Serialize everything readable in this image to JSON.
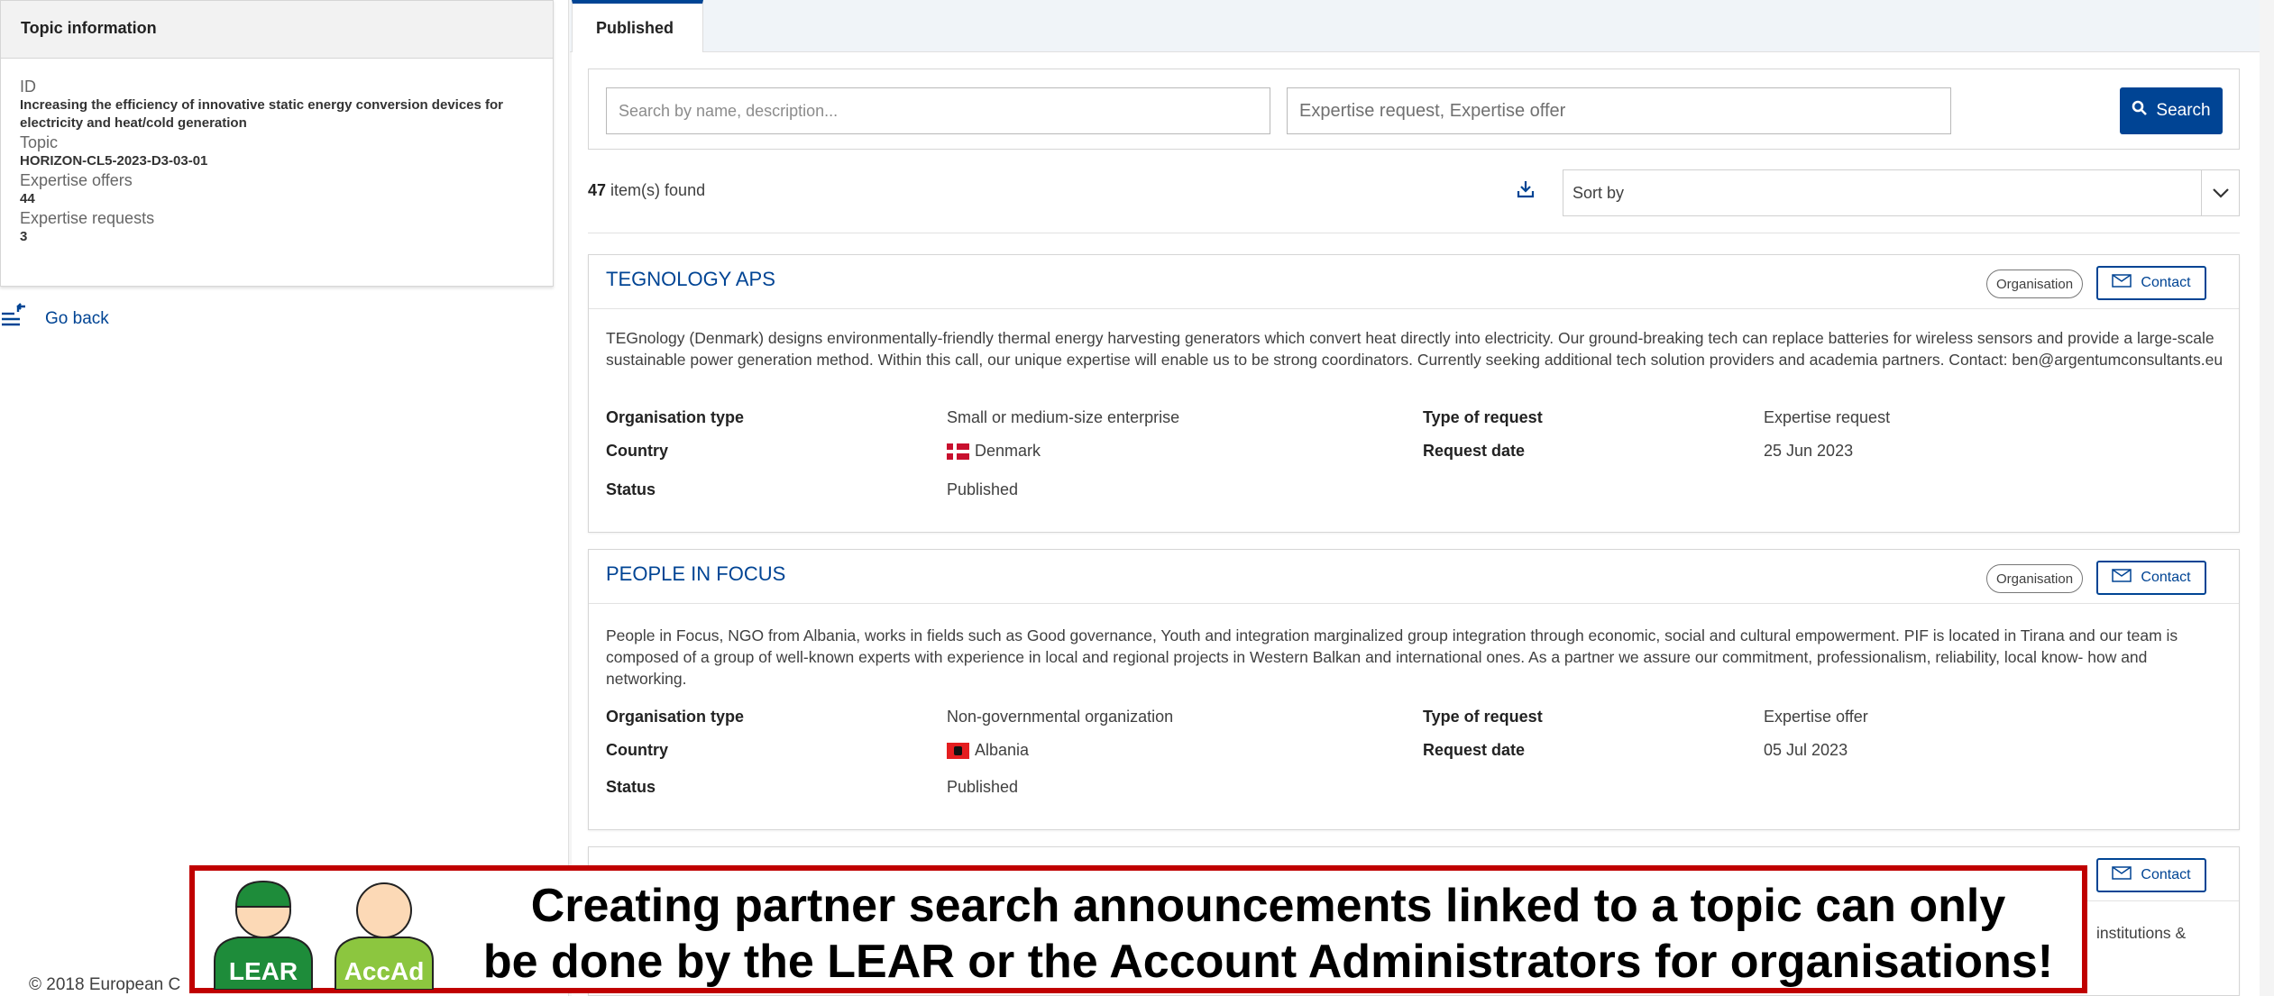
{
  "topic_panel": {
    "header": "Topic information",
    "id_label": "ID",
    "id_value": "Increasing the efficiency of innovative static energy conversion devices for electricity and heat/cold generation",
    "topic_label": "Topic",
    "topic_value": "HORIZON-CL5-2023-D3-03-01",
    "offers_label": "Expertise offers",
    "offers_value": "44",
    "requests_label": "Expertise requests",
    "requests_value": "3"
  },
  "go_back_label": "Go back",
  "tabs": [
    {
      "label": "Published"
    }
  ],
  "search": {
    "name_placeholder": "Search by name, description...",
    "type_value": "Expertise request, Expertise offer",
    "button_label": "Search"
  },
  "results": {
    "count": "47",
    "suffix": "item(s) found"
  },
  "sort": {
    "label": "Sort by"
  },
  "labels": {
    "organisation_type": "Organisation type",
    "country": "Country",
    "status": "Status",
    "type_of_request": "Type of request",
    "request_date": "Request date",
    "badge": "Organisation",
    "contact": "Contact"
  },
  "cards": [
    {
      "title": "TEGNOLOGY APS",
      "description": "TEGnology (Denmark) designs environmentally-friendly thermal energy harvesting generators which convert heat directly into electricity. Our ground-breaking tech can replace batteries for wireless sensors and provide a large-scale sustainable power generation method. Within this call, our unique expertise will enable us to be strong coordinators. Currently seeking additional tech solution providers and academia partners. Contact: ben@argentumconsultants.eu",
      "organisation_type": "Small or medium-size enterprise",
      "country": "Denmark",
      "status": "Published",
      "type_of_request": "Expertise request",
      "request_date": "25 Jun 2023"
    },
    {
      "title": "PEOPLE IN FOCUS",
      "description": "People in Focus, NGO from Albania, works in fields such as Good governance, Youth and integration marginalized group integration through economic, social and cultural empowerment. PIF is located in Tirana and our team is composed of a group of well-known experts with experience in local and regional projects in Western Balkan and international ones. As a partner we assure our commitment, professionalism, reliability, local know- how and networking.",
      "organisation_type": "Non-governmental organization",
      "country": "Albania",
      "status": "Published",
      "type_of_request": "Expertise offer",
      "request_date": "05 Jul 2023"
    }
  ],
  "third_card_partial_text": "institutions &",
  "footer_text": "© 2018 European C",
  "banner": {
    "line1": "Creating partner search announcements linked to a topic can only",
    "line2": "be done by the LEAR or the Account Administrators for organisations!",
    "avatar1_label": "LEAR",
    "avatar2_label": "AccAd"
  },
  "colors": {
    "accent": "#004494",
    "banner_border": "#c00000",
    "lear_green": "#1e8c3a",
    "accad_green": "#8cc63f"
  }
}
